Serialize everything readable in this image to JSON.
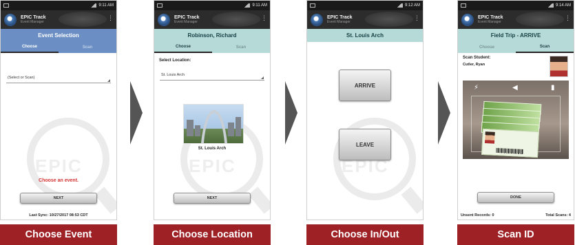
{
  "colors": {
    "caption_background": "#9e2126",
    "caption_text": "#ffffff",
    "blue_header": "#6b8fc4",
    "teal_header": "#b6dad8",
    "error_text": "#d33333",
    "arrow": "#555555"
  },
  "app": {
    "name": "EPIC Track",
    "subtitle": "Event Manager",
    "logo_icon": "epic-globe-icon",
    "menu_icon": "overflow-menu-icon"
  },
  "screens": [
    {
      "caption": "Choose Event",
      "statusbar_time": "9:11 AM",
      "title": "Event Selection",
      "tabs": [
        {
          "label": "Choose",
          "active": true
        },
        {
          "label": "Scan",
          "active": false
        }
      ],
      "select_placeholder": "(Select or Scan)",
      "error_text": "Choose an event.",
      "next_button": "NEXT",
      "footer": "Last Sync: 10/27/2017 08:53 CDT"
    },
    {
      "caption": "Choose Location",
      "statusbar_time": "9:11 AM",
      "title": "Robinson, Richard",
      "tabs": [
        {
          "label": "Choose",
          "active": true
        },
        {
          "label": "Scan",
          "active": false
        }
      ],
      "field_label": "Select Location:",
      "select_value": "St. Louis Arch",
      "photo_caption": "St. Louis Arch",
      "next_button": "NEXT"
    },
    {
      "caption": "Choose In/Out",
      "statusbar_time": "9:12 AM",
      "title": "St. Louis Arch",
      "arrive_button": "ARRIVE",
      "leave_button": "LEAVE"
    },
    {
      "caption": "Scan ID",
      "statusbar_time": "9:14 AM",
      "title": "Field Trip - ARRIVE",
      "tabs": [
        {
          "label": "Choose",
          "active": false
        },
        {
          "label": "Scan",
          "active": true
        }
      ],
      "field_label": "Scan Student:",
      "student_name": "Cutler, Ryan",
      "scanner_controls": [
        "flash-icon",
        "back-icon",
        "camera-switch-icon"
      ],
      "done_button": "DONE",
      "unsent_records": "Unsent Records: 0",
      "total_scans": "Total Scans: 4"
    }
  ]
}
